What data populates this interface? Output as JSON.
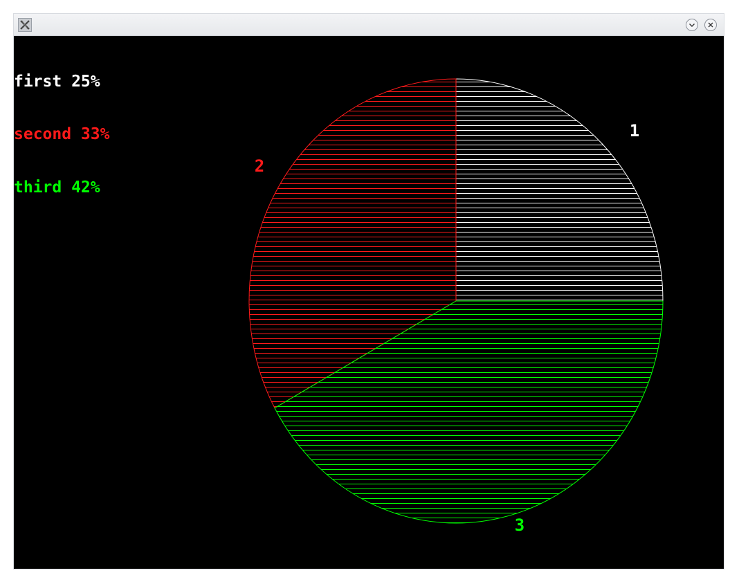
{
  "window": {
    "icon": "x-window-icon",
    "buttons": [
      {
        "name": "minimize",
        "icon": "chevron-down-icon"
      },
      {
        "name": "close",
        "icon": "close-icon"
      }
    ]
  },
  "colors": {
    "background": "#000000",
    "first": "#ffffff",
    "second": "#ff1a1a",
    "third": "#00ff00"
  },
  "legend": [
    {
      "text": "first 25%",
      "color": "#ffffff"
    },
    {
      "text": "second 33%",
      "color": "#ff1a1a"
    },
    {
      "text": "third 42%",
      "color": "#00ff00"
    }
  ],
  "chart_data": {
    "type": "pie",
    "categories": [
      "first",
      "second",
      "third"
    ],
    "values": [
      25,
      33,
      42
    ],
    "slice_labels": [
      "1",
      "2",
      "3"
    ],
    "fill": "horizontal-hatch"
  }
}
